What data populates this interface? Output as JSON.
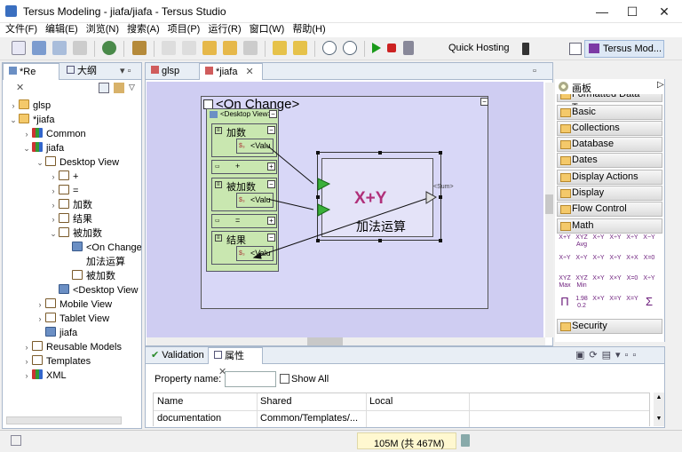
{
  "window": {
    "title": "Tersus Modeling - jiafa/jiafa - Tersus Studio",
    "min": "—",
    "max": "☐",
    "close": "✕"
  },
  "menu": [
    "文件(F)",
    "编辑(E)",
    "浏览(N)",
    "搜索(A)",
    "项目(P)",
    "运行(R)",
    "窗口(W)",
    "帮助(H)"
  ],
  "toolbar": {
    "quick_hosting": "Quick Hosting",
    "perspective": "Tersus Mod..."
  },
  "left": {
    "tabs": [
      "*Re",
      "大纲"
    ],
    "tree": [
      {
        "label": "glsp",
        "indent": 0
      },
      {
        "label": "*jiafa",
        "indent": 0
      },
      {
        "label": "Common",
        "indent": 1
      },
      {
        "label": "jiafa",
        "indent": 1
      },
      {
        "label": "Desktop View",
        "indent": 2
      },
      {
        "label": "+",
        "indent": 3
      },
      {
        "label": "=",
        "indent": 3
      },
      {
        "label": "加数",
        "indent": 3
      },
      {
        "label": "结果",
        "indent": 3
      },
      {
        "label": "被加数",
        "indent": 3
      },
      {
        "label": "<On Change",
        "indent": 4
      },
      {
        "label": "加法运算",
        "indent": 4
      },
      {
        "label": "被加数",
        "indent": 4
      },
      {
        "label": "<Desktop View",
        "indent": 3
      },
      {
        "label": "Mobile View",
        "indent": 2
      },
      {
        "label": "Tablet View",
        "indent": 2
      },
      {
        "label": "jiafa",
        "indent": 2
      },
      {
        "label": "Reusable Models",
        "indent": 1
      },
      {
        "label": "Templates",
        "indent": 1
      },
      {
        "label": "XML",
        "indent": 1
      }
    ]
  },
  "editor": {
    "tabs": [
      "glsp",
      "*jiafa"
    ],
    "diagram": {
      "title": "<On Change>",
      "view": "<Desktop View>",
      "fields": [
        "加数",
        "+",
        "被加数",
        "=",
        "结果"
      ],
      "value": "<Valu",
      "sum_label": "X+Y",
      "op_name": "加法运算",
      "out": "<Sum>"
    }
  },
  "palette": {
    "title": "画板",
    "cut_top": "Formatted Data Types",
    "categories": [
      "Basic",
      "Collections",
      "Database",
      "Dates",
      "Display Actions",
      "Display",
      "Flow Control",
      "Math",
      "Security"
    ],
    "math_icons": [
      "X+Y",
      "XYZ Avg",
      "X÷Y",
      "X÷Y",
      "X÷Y",
      "X−Y",
      "X÷Y",
      "X÷Y",
      "X÷Y",
      "X÷Y",
      "X+X",
      "X=0",
      "XYZ Max",
      "XYZ Min",
      "X×Y",
      "X×Y",
      "X=0",
      "X÷Y",
      "Π",
      "1.98 0.2",
      "X×Y",
      "X=Y",
      "X=Y",
      "Σ"
    ]
  },
  "props": {
    "tabs": [
      "Validation",
      "属性"
    ],
    "property_name_label": "Property name:",
    "show_all": "Show All",
    "headers": [
      "Name",
      "Shared",
      "Local"
    ],
    "rows": [
      [
        "documentation",
        "Common/Templates/...",
        ""
      ]
    ]
  },
  "status": {
    "memory": "105M (共 467M)"
  }
}
